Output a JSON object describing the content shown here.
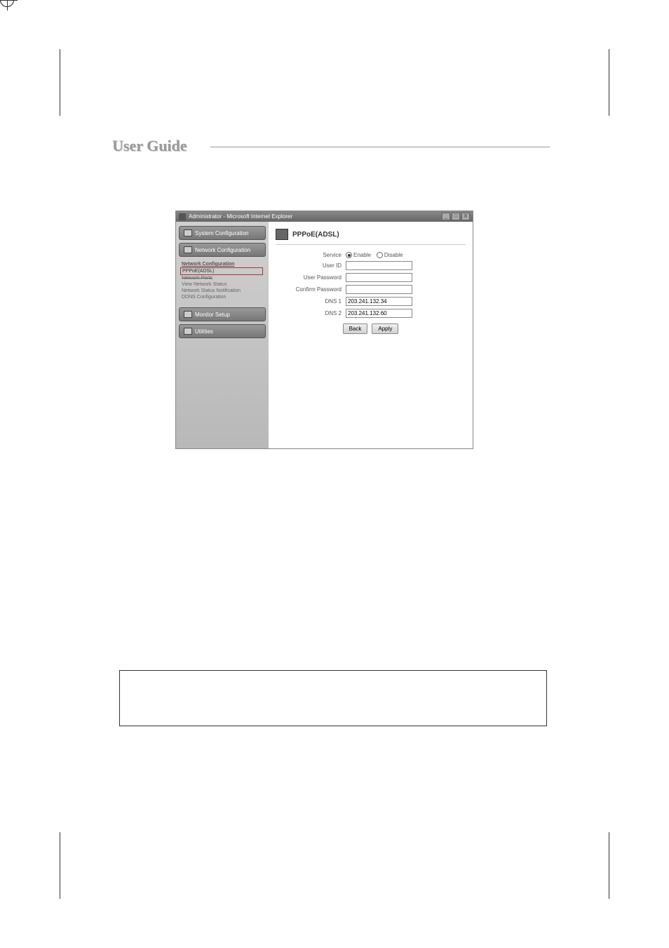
{
  "page_title": "User Guide",
  "window": {
    "title": "Administrator - Microsoft Internet Explorer",
    "controls": {
      "minimize": "_",
      "maximize": "□",
      "close": "X"
    }
  },
  "sidebar": {
    "buttons": [
      {
        "label": "System Configuration"
      },
      {
        "label": "Network Configuration"
      }
    ],
    "submenu": {
      "header": "Network Configuration",
      "items": [
        {
          "label": "PPPoE(ADSL)",
          "highlighted": true
        },
        {
          "label": "Network Ports"
        },
        {
          "label": "View Network Status"
        },
        {
          "label": "Network Status Notification"
        },
        {
          "label": "DDNS Configuration"
        }
      ]
    },
    "lower_buttons": [
      {
        "label": "Monitor Setup"
      },
      {
        "label": "Utilities"
      }
    ]
  },
  "content": {
    "title": "PPPoE(ADSL)",
    "fields": {
      "service": {
        "label": "Service",
        "enable": "Enable",
        "disable": "Disable",
        "selected": "enable"
      },
      "user_id": {
        "label": "User ID",
        "value": ""
      },
      "user_password": {
        "label": "User Password",
        "value": ""
      },
      "confirm_password": {
        "label": "Confirm Password",
        "value": ""
      },
      "dns1": {
        "label": "DNS 1",
        "value": "203.241.132.34"
      },
      "dns2": {
        "label": "DNS 2",
        "value": "203.241.132.60"
      }
    },
    "buttons": {
      "back": "Back",
      "apply": "Apply"
    }
  }
}
